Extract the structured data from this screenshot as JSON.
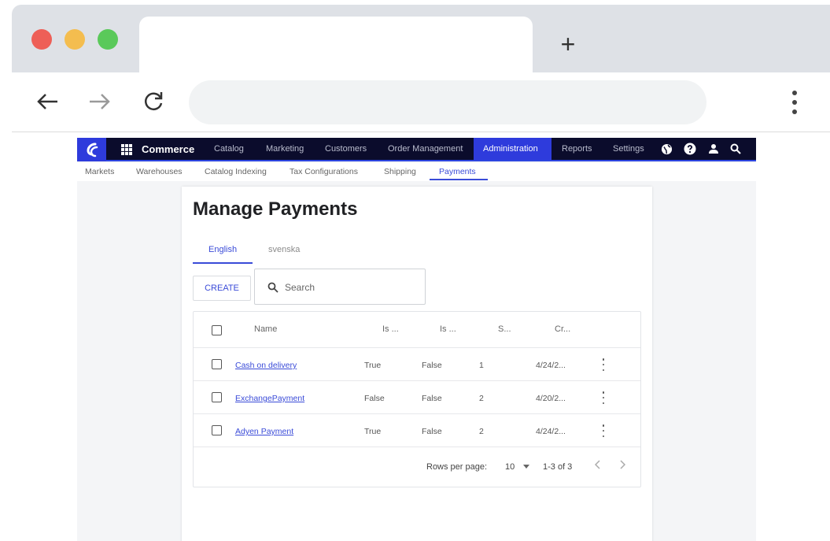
{
  "browser": {
    "new_tab_glyph": "+"
  },
  "app": {
    "title": "Commerce",
    "topnav": [
      {
        "label": "Catalog"
      },
      {
        "label": "Marketing"
      },
      {
        "label": "Customers"
      },
      {
        "label": "Order Management"
      },
      {
        "label": "Administration"
      },
      {
        "label": "Reports"
      },
      {
        "label": "Settings"
      }
    ],
    "active_topnav": "Administration",
    "subnav": [
      {
        "label": "Markets"
      },
      {
        "label": "Warehouses"
      },
      {
        "label": "Catalog Indexing"
      },
      {
        "label": "Tax Configurations"
      },
      {
        "label": "Shipping"
      },
      {
        "label": "Payments"
      }
    ],
    "active_subnav": "Payments"
  },
  "page": {
    "title": "Manage Payments",
    "languages": [
      {
        "label": "English"
      },
      {
        "label": "svenska"
      }
    ],
    "create_label": "CREATE",
    "search_placeholder": "Search"
  },
  "table": {
    "columns": [
      "Name",
      "Is ...",
      "Is ...",
      "S...",
      "Cr..."
    ],
    "rows": [
      {
        "name": "Cash on delivery",
        "col1": "True",
        "col2": "False",
        "col3": "1",
        "col4": "4/24/2..."
      },
      {
        "name": "ExchangePayment",
        "col1": "False",
        "col2": "False",
        "col3": "2",
        "col4": "4/20/2..."
      },
      {
        "name": "Adyen Payment",
        "col1": "True",
        "col2": "False",
        "col3": "2",
        "col4": "4/24/2..."
      }
    ],
    "footer": {
      "rows_per_page_label": "Rows per page:",
      "rows_per_page": "10",
      "range": "1-3 of 3"
    }
  },
  "colors": {
    "topnav_bg": "#0b0c2c",
    "accent": "#2e3bdc",
    "link": "#3a4bd8"
  }
}
